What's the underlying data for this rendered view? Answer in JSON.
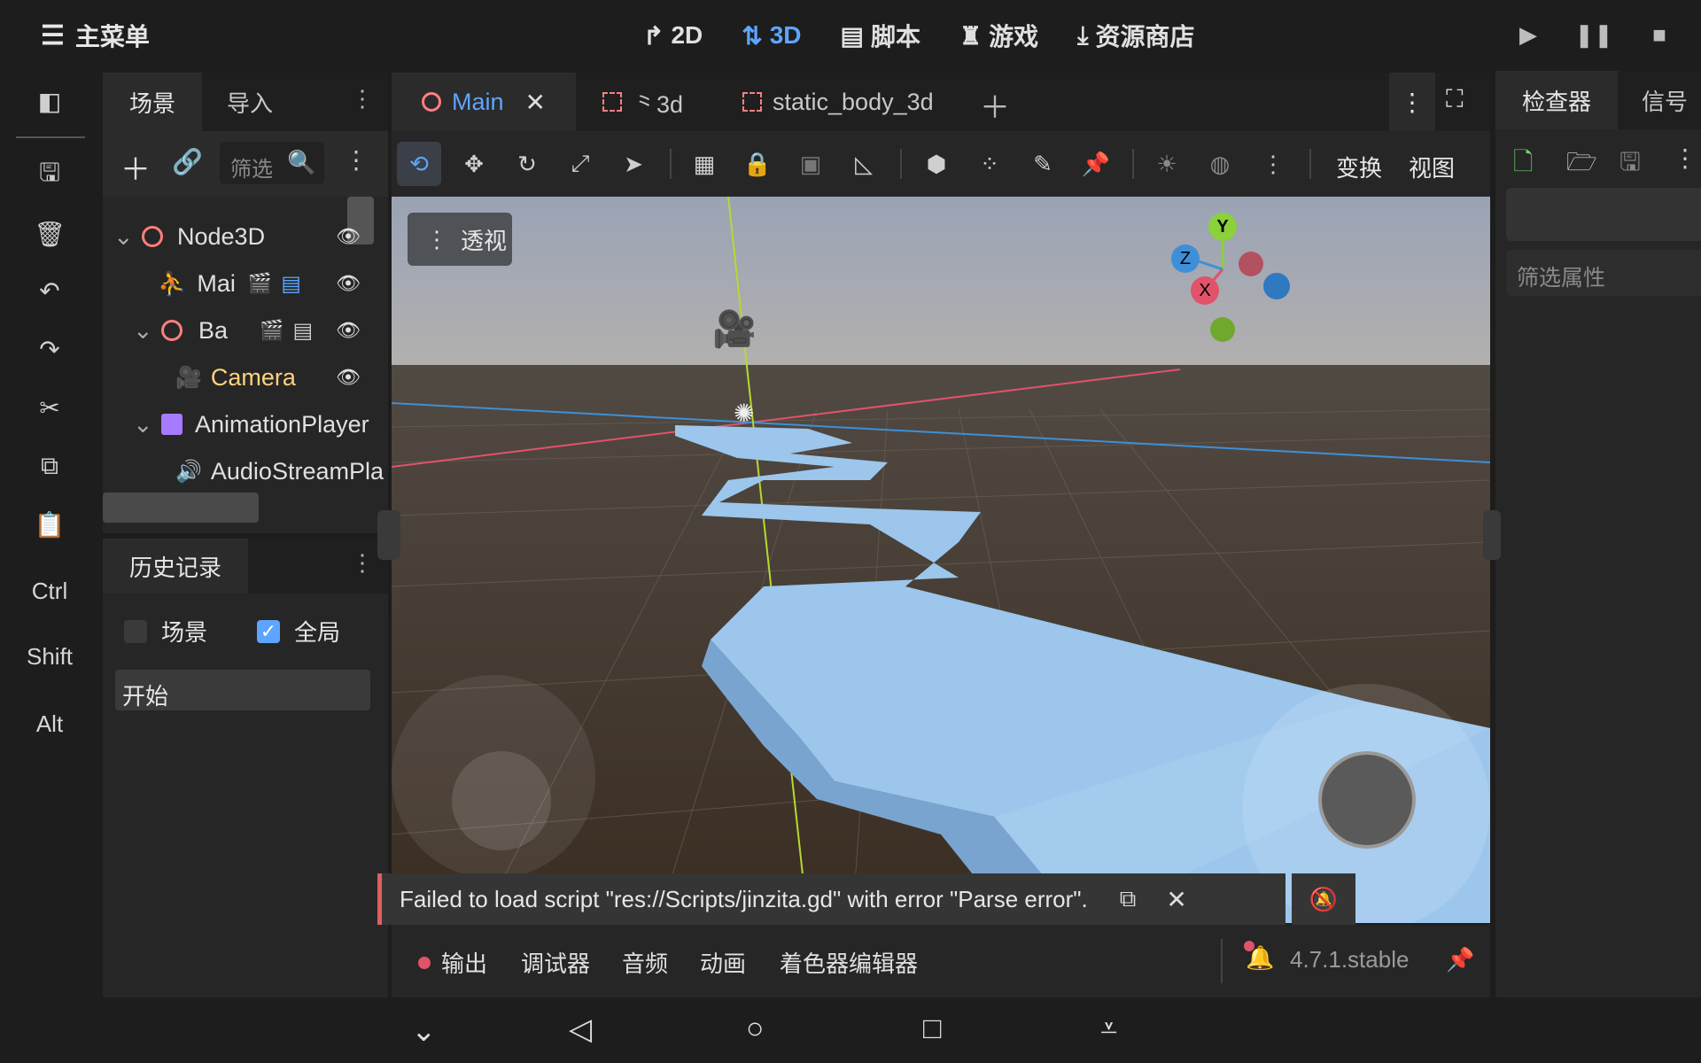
{
  "topbar": {
    "main_menu": "主菜单",
    "modes": [
      {
        "label": "2D",
        "icon": "2d-icon",
        "active": false
      },
      {
        "label": "3D",
        "icon": "3d-icon",
        "active": true
      },
      {
        "label": "脚本",
        "icon": "script-icon",
        "active": false
      },
      {
        "label": "游戏",
        "icon": "game-icon",
        "active": false
      },
      {
        "label": "资源商店",
        "icon": "asset-library-icon",
        "active": false
      }
    ],
    "accent": "#5ea5ff"
  },
  "toolstrip": {
    "modifiers": [
      "Ctrl",
      "Shift",
      "Alt"
    ]
  },
  "scene_dock": {
    "tabs": [
      "场景",
      "导入"
    ],
    "filter_placeholder": "筛选",
    "nodes": [
      {
        "name": "Node3D",
        "icon": "node3d-icon",
        "color": "#fc7f7f"
      },
      {
        "name": "Mai",
        "icon": "character-icon",
        "color": "#fc7f7f"
      },
      {
        "name": "Ba",
        "icon": "node3d-icon",
        "color": "#fc7f7f"
      },
      {
        "name": "Camera",
        "icon": "camera-icon",
        "color": "#fc7f7f"
      },
      {
        "name": "AnimationPlayer",
        "icon": "animation-player-icon",
        "color": "#a77bff"
      },
      {
        "name": "AudioStreamPla",
        "icon": "audio-icon",
        "color": "#e0e0e0"
      }
    ]
  },
  "history_dock": {
    "title": "历史记录",
    "scene_label": "场景",
    "scene_checked": false,
    "global_label": "全局",
    "global_checked": true,
    "entries": [
      "开始"
    ]
  },
  "editor_tabs": [
    {
      "label": "Main",
      "active": true
    },
    {
      "label": "⺀3d",
      "active": false
    },
    {
      "label": "static_body_3d",
      "active": false
    }
  ],
  "viewport_toolbar": {
    "transform": "变换",
    "view": "视图"
  },
  "viewport": {
    "perspective_label": "透视",
    "gizmo": {
      "x": "X",
      "y": "Y",
      "z": "Z"
    }
  },
  "error_toast": {
    "message": "Failed to load script \"res://Scripts/jinzita.gd\" with error \"Parse error\"."
  },
  "bottom_panel": {
    "tabs": [
      "输出",
      "调试器",
      "音频",
      "动画",
      "着色器编辑器"
    ],
    "version": "4.7.1.stable"
  },
  "inspector": {
    "tabs": [
      "检查器",
      "信号"
    ],
    "filter_placeholder": "筛选属性"
  }
}
